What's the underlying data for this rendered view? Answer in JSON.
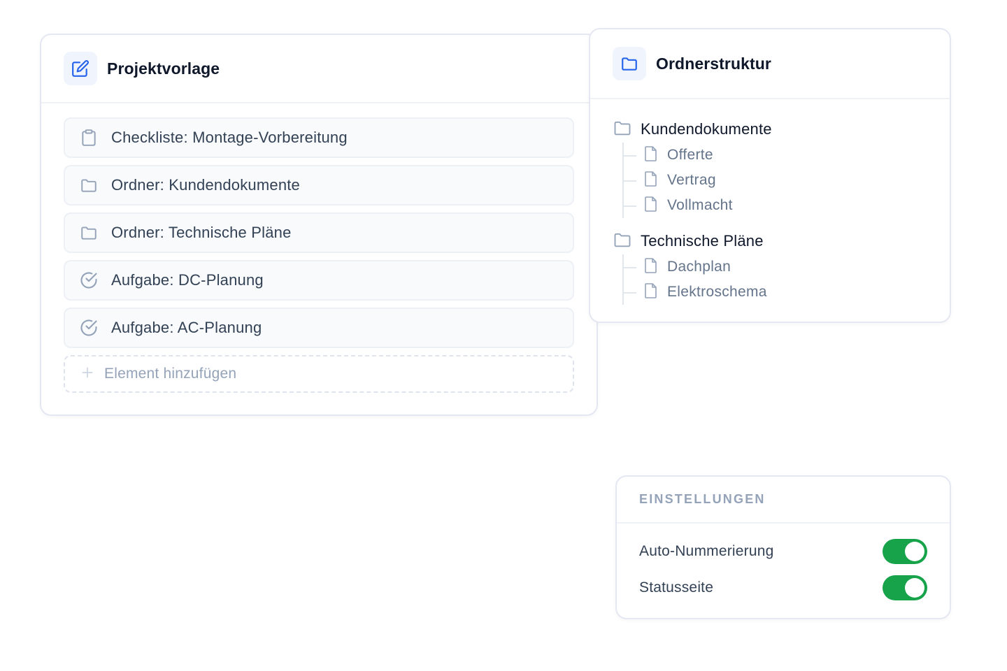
{
  "colors": {
    "accent": "#2563eb",
    "icon_gray": "#94a3b8",
    "toggle_on": "#16a34a"
  },
  "template": {
    "title": "Projektvorlage",
    "header_icon": "edit-icon",
    "items": [
      {
        "icon": "clipboard-icon",
        "label": "Checkliste: Montage-Vorbereitung"
      },
      {
        "icon": "folder-icon",
        "label": "Ordner: Kundendokumente"
      },
      {
        "icon": "folder-icon",
        "label": "Ordner: Technische Pläne"
      },
      {
        "icon": "check-circle-icon",
        "label": "Aufgabe: DC-Planung"
      },
      {
        "icon": "check-circle-icon",
        "label": "Aufgabe: AC-Planung"
      }
    ],
    "add_label": "Element hinzufügen",
    "add_icon": "plus-icon"
  },
  "folders": {
    "title": "Ordnerstruktur",
    "header_icon": "folder-icon",
    "tree": [
      {
        "name": "Kundendokumente",
        "files": [
          "Offerte",
          "Vertrag",
          "Vollmacht"
        ]
      },
      {
        "name": "Technische Pläne",
        "files": [
          "Dachplan",
          "Elektroschema"
        ]
      }
    ]
  },
  "settings": {
    "title": "EINSTELLUNGEN",
    "options": [
      {
        "label": "Auto-Nummerierung",
        "enabled": true
      },
      {
        "label": "Statusseite",
        "enabled": true
      }
    ]
  }
}
